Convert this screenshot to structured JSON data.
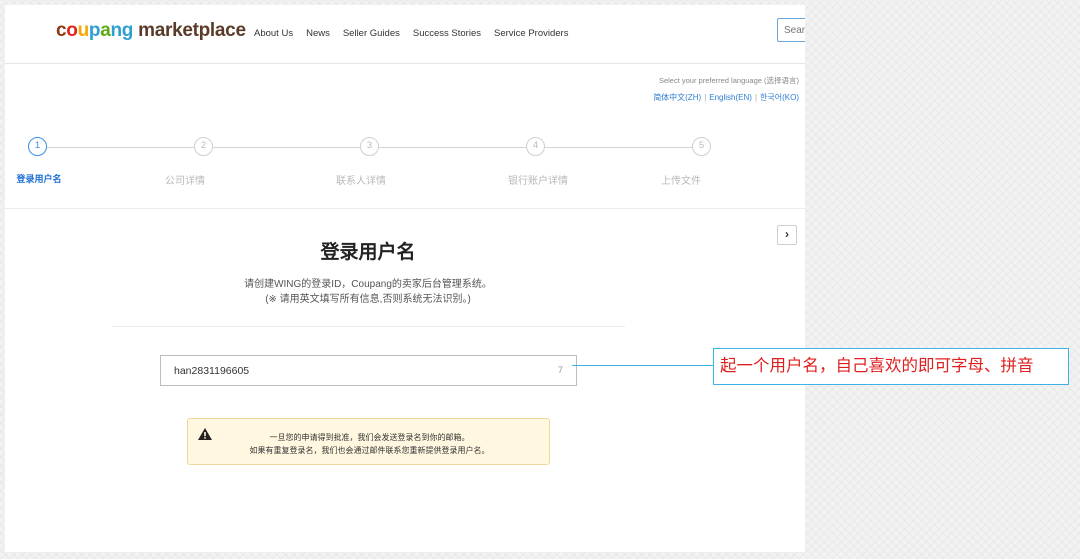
{
  "header": {
    "logo": {
      "parts": [
        "c",
        "o",
        "u",
        "p",
        "a",
        "ng"
      ],
      "rest": "marketplace"
    },
    "nav": [
      "About Us",
      "News",
      "Seller Guides",
      "Success Stories",
      "Service Providers"
    ],
    "search_placeholder": "Search"
  },
  "language": {
    "prompt": "Select your preferred language (选择语言)",
    "options": [
      "简体中文(ZH)",
      "English(EN)",
      "한국어(KO)"
    ]
  },
  "steps": [
    {
      "num": "1",
      "label": "登录用户名",
      "active": true
    },
    {
      "num": "2",
      "label": "公司详情",
      "active": false
    },
    {
      "num": "3",
      "label": "联系人详情",
      "active": false
    },
    {
      "num": "4",
      "label": "银行账户详情",
      "active": false
    },
    {
      "num": "5",
      "label": "上传文件",
      "active": false
    }
  ],
  "form": {
    "title": "登录用户名",
    "description_line1": "请创建WING的登录ID，Coupang的卖家后台管理系统。",
    "description_line2": "(※ 请用英文填写所有信息,否则系统无法识别。)",
    "username_value": "han2831196605",
    "char_count": "7"
  },
  "notice": {
    "line1": "一旦您的申请得到批准，我们会发送登录名到你的邮箱。",
    "line2": "如果有重复登录名，我们也会通过邮件联系您重新提供登录用户名。"
  },
  "annotation": {
    "text": "起一个用户名，自己喜欢的即可字母、拼音"
  },
  "colors": {
    "accent": "#3a8ee6",
    "annotation_text": "#e02020",
    "annotation_border": "#3fb3e6",
    "notice_bg": "#fff7e0"
  },
  "icons": {
    "next": "chevron-right-icon",
    "warning": "warning-icon"
  }
}
